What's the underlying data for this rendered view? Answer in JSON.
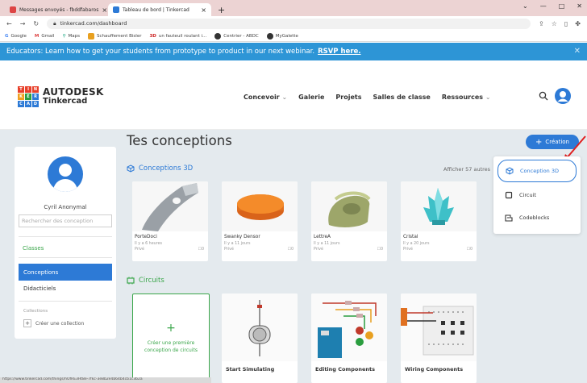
{
  "browser": {
    "tabs": [
      {
        "title": "Messages envoyés - fbddfabaros",
        "active": false
      },
      {
        "title": "Tableau de bord | Tinkercad",
        "active": true
      }
    ],
    "url": "tinkercad.com/dashboard",
    "bookmarks": [
      "Google",
      "Gmail",
      "Maps",
      "Schauffement Bisler",
      "un fauteuil roulant i...",
      "Centrier - ABDC",
      "MyGalette"
    ]
  },
  "banner": {
    "text": "Educators: Learn how to get your students from prototype to product in our next webinar.",
    "link": "RSVP here.",
    "close": "✕"
  },
  "logo": {
    "letters": [
      "T",
      "I",
      "N",
      "K",
      "E",
      "R",
      "C",
      "A",
      "D"
    ],
    "line1": "AUTODESK",
    "line2": "Tinkercad"
  },
  "nav": {
    "items": [
      "Concevoir",
      "Galerie",
      "Projets",
      "Salles de classe",
      "Ressources"
    ]
  },
  "sidebar": {
    "username": "Cyril Anonymal",
    "search_placeholder": "Rechercher des conception",
    "classes": "Classes",
    "conceptions": "Conceptions",
    "tutorials": "Didacticiels",
    "collections_label": "Collections",
    "create_collection": "Créer une collection"
  },
  "main": {
    "title": "Tes conceptions",
    "designs_3d_label": "Conceptions 3D",
    "show_more": "Afficher 57 autres",
    "designs": [
      {
        "name": "PorteDoci",
        "date": "Il y a 6 heures",
        "privacy": "Privé",
        "count": "0"
      },
      {
        "name": "Swanky Densor",
        "date": "Il y a 11 jours",
        "privacy": "Privé",
        "count": "0"
      },
      {
        "name": "LettreA",
        "date": "Il y a 11 jours",
        "privacy": "Privé",
        "count": "0"
      },
      {
        "name": "Cristal",
        "date": "Il y a 20 jours",
        "privacy": "Privé",
        "count": "0"
      }
    ],
    "circuits_label": "Circuits",
    "create_circuit": "Créer une première conception de circuits",
    "circuits": [
      "Start Simulating",
      "Editing Components",
      "Wiring Components"
    ]
  },
  "create": {
    "button": "Création",
    "menu": [
      "Conception 3D",
      "Circuit",
      "Codeblocks"
    ]
  },
  "status": {
    "text": "https://www.tinkercad.com/things/hOfRE3Ht8e-7fkc-3e8b2e4b64b4cb1c3b2a"
  },
  "colors": {
    "accent": "#2d7ad6",
    "banner": "#2d95d6",
    "green": "#3aa64a"
  }
}
